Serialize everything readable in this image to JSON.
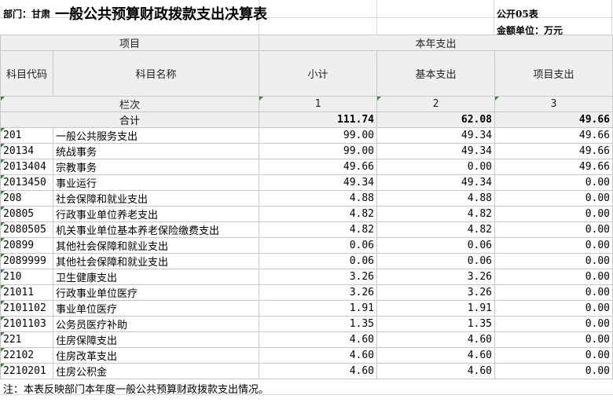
{
  "header": {
    "department": "部门：甘肃",
    "title": "一般公共预算财政拨款支出决算表",
    "form_code": "公开05表",
    "unit": "金额单位：万元"
  },
  "columns": {
    "item": "项目",
    "current_year": "本年支出",
    "code": "科目代码",
    "name": "科目名称",
    "subtotal": "小计",
    "basic": "基本支出",
    "project": "项目支出",
    "column_index_label": "栏次",
    "col1": "1",
    "col2": "2",
    "col3": "3"
  },
  "total": {
    "label": "合计",
    "subtotal": "111.74",
    "basic": "62.08",
    "project": "49.66"
  },
  "rows": [
    {
      "code": "201",
      "name": "一般公共服务支出",
      "subtotal": "99.00",
      "basic": "49.34",
      "project": "49.66"
    },
    {
      "code": "20134",
      "name": "统战事务",
      "subtotal": "99.00",
      "basic": "49.34",
      "project": "49.66"
    },
    {
      "code": "2013404",
      "name": "宗教事务",
      "subtotal": "49.66",
      "basic": "0.00",
      "project": "49.66"
    },
    {
      "code": "2013450",
      "name": "事业运行",
      "subtotal": "49.34",
      "basic": "49.34",
      "project": "0.00"
    },
    {
      "code": "208",
      "name": "社会保障和就业支出",
      "subtotal": "4.88",
      "basic": "4.88",
      "project": "0.00"
    },
    {
      "code": "20805",
      "name": "行政事业单位养老支出",
      "subtotal": "4.82",
      "basic": "4.82",
      "project": "0.00"
    },
    {
      "code": "2080505",
      "name": "机关事业单位基本养老保险缴费支出",
      "subtotal": "4.82",
      "basic": "4.82",
      "project": "0.00"
    },
    {
      "code": "20899",
      "name": "其他社会保障和就业支出",
      "subtotal": "0.06",
      "basic": "0.06",
      "project": "0.00"
    },
    {
      "code": "2089999",
      "name": "其他社会保障和就业支出",
      "subtotal": "0.06",
      "basic": "0.06",
      "project": "0.00"
    },
    {
      "code": "210",
      "name": "卫生健康支出",
      "subtotal": "3.26",
      "basic": "3.26",
      "project": "0.00"
    },
    {
      "code": "21011",
      "name": "行政事业单位医疗",
      "subtotal": "3.26",
      "basic": "3.26",
      "project": "0.00"
    },
    {
      "code": "2101102",
      "name": "事业单位医疗",
      "subtotal": "1.91",
      "basic": "1.91",
      "project": "0.00"
    },
    {
      "code": "2101103",
      "name": "公务员医疗补助",
      "subtotal": "1.35",
      "basic": "1.35",
      "project": "0.00"
    },
    {
      "code": "221",
      "name": "住房保障支出",
      "subtotal": "4.60",
      "basic": "4.60",
      "project": "0.00"
    },
    {
      "code": "22102",
      "name": "住房改革支出",
      "subtotal": "4.60",
      "basic": "4.60",
      "project": "0.00"
    },
    {
      "code": "2210201",
      "name": "住房公积金",
      "subtotal": "4.60",
      "basic": "4.60",
      "project": "0.00"
    }
  ],
  "note": "注：本表反映部门本年度一般公共预算财政拨款支出情况。"
}
